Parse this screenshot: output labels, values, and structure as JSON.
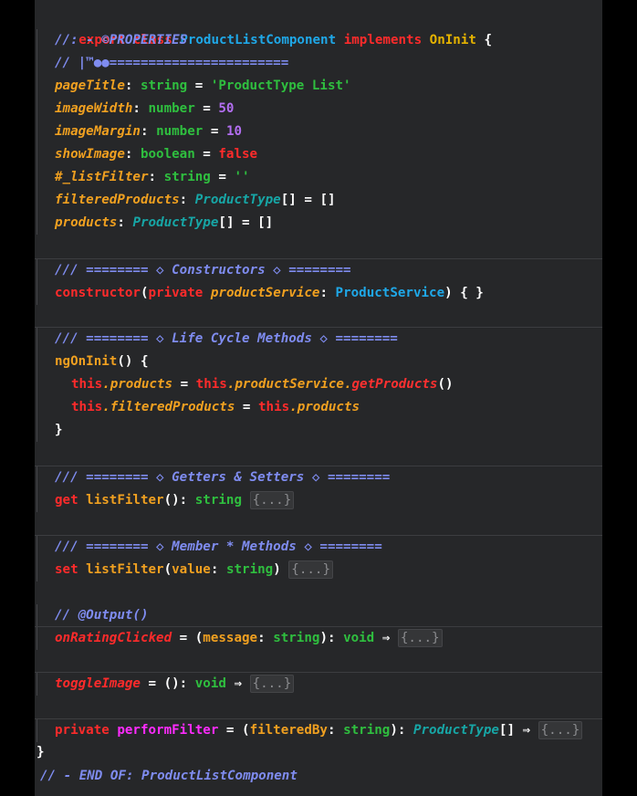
{
  "code": {
    "class_decl": {
      "export": "export",
      "class": "class",
      "name": "ProductListComponent",
      "implements": "implements",
      "interface": "OnInit",
      "open": " {"
    },
    "comment_properties": "//: - ©PROPERTIES",
    "comment_divider": "// |™●●=======================",
    "pageTitle": {
      "name": "pageTitle",
      "type": "string",
      "eq": " = ",
      "value": "'ProductType List'"
    },
    "imageWidth": {
      "name": "imageWidth",
      "type": "number",
      "eq": " = ",
      "value": "50"
    },
    "imageMargin": {
      "name": "imageMargin",
      "type": "number",
      "eq": " = ",
      "value": "10"
    },
    "showImage": {
      "name": "showImage",
      "type": "boolean",
      "eq": " = ",
      "value": "false"
    },
    "listFilter": {
      "name": "#_listFilter",
      "type": "string",
      "eq": " = ",
      "value": "''"
    },
    "filteredProducts": {
      "name": "filteredProducts",
      "type": "ProductType",
      "rest": "[] = []"
    },
    "products": {
      "name": "products",
      "type": "ProductType",
      "rest": "[] = []"
    },
    "comment_constructors": "/// ======== ◇ Constructors ◇ ========",
    "constructor": {
      "kw": "constructor",
      "paren": "(",
      "private": "private",
      "param": "productService",
      "type": "ProductService",
      "close": ") { }"
    },
    "comment_lifecycle": "/// ======== ◇ Life Cycle Methods ◇ ========",
    "ngOnInit": {
      "name": "ngOnInit",
      "rest": "() {"
    },
    "ngOnInit_line1": {
      "this1": "this",
      "prop1": ".products",
      "eq": " = ",
      "this2": "this",
      "prop2": ".productService.",
      "method": "getProducts",
      "call": "()"
    },
    "ngOnInit_line2": {
      "this1": "this",
      "prop1": ".filteredProducts",
      "eq": " = ",
      "this2": "this",
      "prop2": ".products"
    },
    "close_brace": "}",
    "comment_getters": "/// ======== ◇ Getters & Setters ◇ ========",
    "getter": {
      "kw": "get",
      "name": "listFilter",
      "rest": "(): ",
      "type": "string",
      "fold": "{...}"
    },
    "comment_member": "/// ======== ◇ Member * Methods ◇ ========",
    "setter": {
      "kw": "set",
      "name": "listFilter",
      "paren": "(",
      "param": "value",
      "colon": ": ",
      "type": "string",
      "close": ") ",
      "fold": "{...}"
    },
    "comment_output": "// @Output()",
    "onRatingClicked": {
      "name": "onRatingClicked",
      "eq": " = (",
      "param": "message",
      "colon": ": ",
      "type": "string",
      "ret": "): ",
      "void": "void",
      "arrow": " ⇒ ",
      "fold": "{...}"
    },
    "toggleImage": {
      "name": "toggleImage",
      "eq": " = (): ",
      "void": "void",
      "arrow": " ⇒ ",
      "fold": "{...}"
    },
    "performFilter": {
      "private": "private",
      "name": "performFilter",
      "eq": " = (",
      "param": "filteredBy",
      "colon": ": ",
      "type": "string",
      "ret": "): ",
      "rtype": "ProductType",
      "arr": "[]",
      "arrow": " ⇒ ",
      "fold": "{...}"
    },
    "class_close": "}",
    "comment_end": "// - END OF: ProductListComponent"
  }
}
